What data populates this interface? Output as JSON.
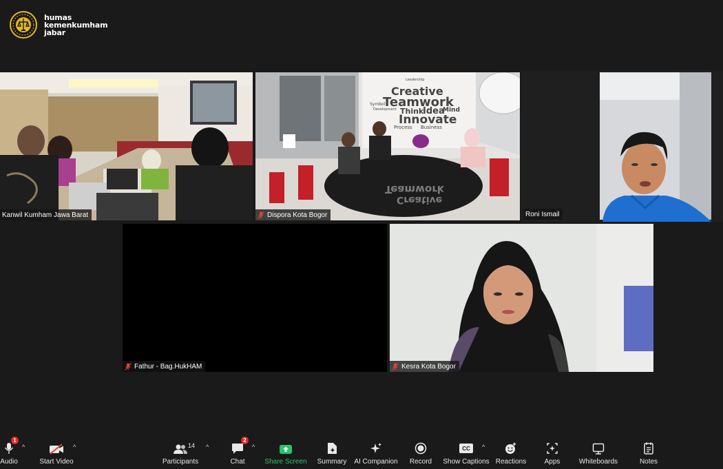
{
  "watermark": {
    "line1": "humas",
    "line2": "kemenkumham",
    "line3": "jabar"
  },
  "participants": [
    {
      "name": "Kanwil Kumham Jawa Barat",
      "muted": false
    },
    {
      "name": "Dispora Kota Bogor",
      "muted": true,
      "wall_text": [
        "Leadership",
        "Creative",
        "Teamwork",
        "Think",
        "Idea",
        "Mind",
        "Innovate",
        "Process",
        "Business",
        "Symbol",
        "Development"
      ]
    },
    {
      "name": "Roni Ismail",
      "muted": false,
      "active_speaker": true
    },
    {
      "name": "Fathur - Bag.HukHAM",
      "muted": true,
      "video_off": true
    },
    {
      "name": "Kesra Kota Bogor",
      "muted": true
    }
  ],
  "toolbar": {
    "audio": {
      "label": "Audio",
      "badge": "1"
    },
    "video": {
      "label": "Start Video"
    },
    "participants": {
      "label": "Participants",
      "count": "14"
    },
    "chat": {
      "label": "Chat",
      "badge": "2"
    },
    "share": {
      "label": "Share Screen"
    },
    "summary": {
      "label": "Summary"
    },
    "ai": {
      "label": "AI Companion"
    },
    "record": {
      "label": "Record"
    },
    "captions": {
      "label": "Show Captions",
      "icon_text": "CC"
    },
    "reactions": {
      "label": "Reactions"
    },
    "apps": {
      "label": "Apps"
    },
    "whiteboards": {
      "label": "Whiteboards"
    },
    "notes": {
      "label": "Notes"
    }
  },
  "colors": {
    "active_border": "#c9e07a",
    "share_green": "#29c467",
    "badge_red": "#e02828",
    "mute_red": "#e0433a"
  }
}
